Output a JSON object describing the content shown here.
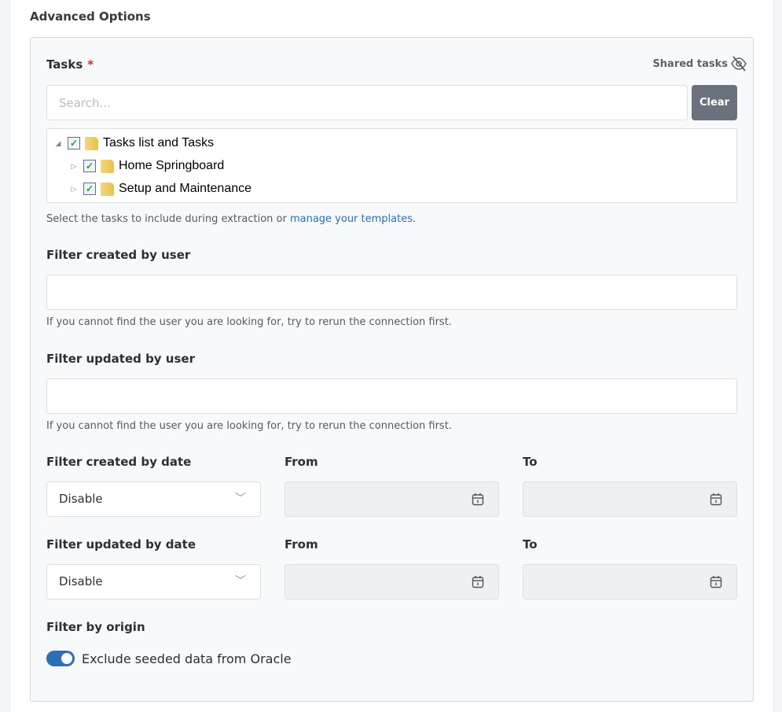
{
  "section_title": "Advanced Options",
  "tasks": {
    "label": "Tasks",
    "required_mark": "*",
    "shared_label": "Shared tasks",
    "search_placeholder": "Search...",
    "clear_label": "Clear",
    "tree": [
      {
        "label": "Tasks list and Tasks",
        "checked": true,
        "expanded": true
      },
      {
        "label": "Home Springboard",
        "checked": true,
        "expanded": false
      },
      {
        "label": "Setup and Maintenance",
        "checked": true,
        "expanded": false
      }
    ],
    "help_prefix": "Select the tasks to include during extraction or ",
    "help_link": "manage your templates",
    "help_suffix": "."
  },
  "created_user": {
    "label": "Filter created by user",
    "value": "",
    "help": "If you cannot find the user you are looking for, try to rerun the connection first."
  },
  "updated_user": {
    "label": "Filter updated by user",
    "value": "",
    "help": "If you cannot find the user you are looking for, try to rerun the connection first."
  },
  "created_date": {
    "label": "Filter created by date",
    "value": "Disable",
    "from": "From",
    "to": "To"
  },
  "updated_date": {
    "label": "Filter updated by date",
    "value": "Disable",
    "from": "From",
    "to": "To"
  },
  "origin": {
    "label": "Filter by origin",
    "toggle_label": "Exclude seeded data from Oracle",
    "toggle_on": true
  },
  "colors": {
    "accent": "#2f6db5",
    "clear_button": "#6c727d"
  }
}
